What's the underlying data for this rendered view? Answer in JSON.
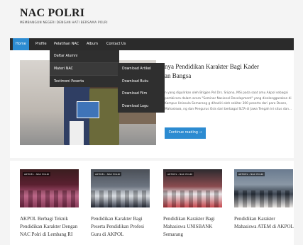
{
  "site": {
    "title": "NAC POLRI",
    "tagline": "MEMBANGUN NEGERI DENGAN HATI BERSAMA POLRI"
  },
  "nav": {
    "items": [
      {
        "label": "Home",
        "active": true
      },
      {
        "label": "Profile",
        "active": false
      },
      {
        "label": "Pelatihan NAC",
        "active": false
      },
      {
        "label": "Album",
        "active": false
      },
      {
        "label": "Contact Us",
        "active": false
      }
    ]
  },
  "dropdown": {
    "items": [
      "Daftar Alumni",
      "Materi NAC",
      "Testimoni Peserta"
    ],
    "submenu": [
      "Download Artikel",
      "Download Buku",
      "Download Film",
      "Download Lagu"
    ]
  },
  "featured": {
    "title_line1": "nya Pendidikan Karakter Bagi Kader",
    "title_line2": "an Bangsa",
    "excerpt": "n yang digulirkan oleh Brigjen Pol Drs. Srijono, MSi pada saat amu Akpol sebagai pembicara dalam acara \"Seminar Nasional Development\" yang diselenggarakan di Kampus Unissula Semarang g dihadiri oleh sekitar 300 peserta dari para Dosen, Mahasiswa, ng dan Pengurus Osis dari berbagai SLTA di Jawa Tengah ini situs dan...",
    "read_more": "Continue reading →"
  },
  "related": [
    {
      "badge": "ARTIKEL - NAC POLRI",
      "title": "AKPOL Berbagi Teknik Pendidikan Karakter Dengan NAC Polri di Lembang RI"
    },
    {
      "badge": "ARTIKEL - NAC POLRI",
      "title": "Pendidikan Karakter Bagi Peserta Pendidikan Profesi Guru di AKPOL"
    },
    {
      "badge": "ARTIKEL - NAC POLRI",
      "title": "Pendidikan Karakter Bagi Mahasiswa UNISBANK Semarang"
    },
    {
      "badge": "ARTIKEL - NAC POLRI",
      "title": "Pendidikan Karakter Mahasiswa ATEM di AKPOL"
    }
  ],
  "colors": {
    "accent": "#2c8bd1",
    "navbar": "#2b2b2b",
    "dropdown": "#2f2f2f"
  }
}
